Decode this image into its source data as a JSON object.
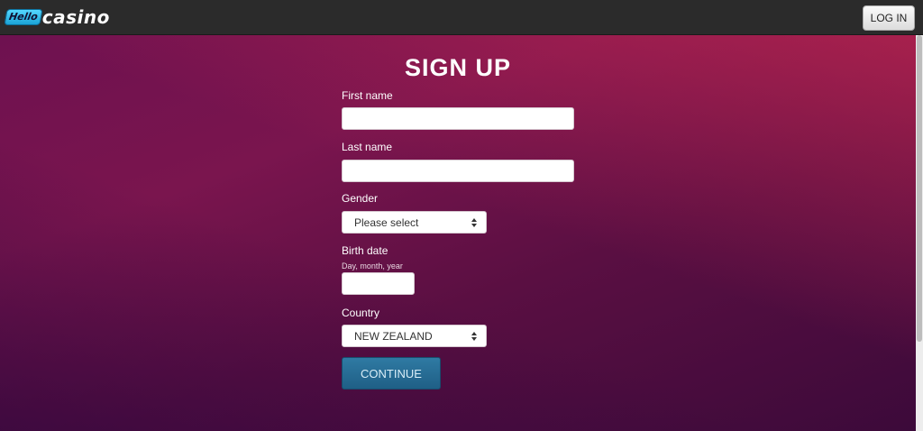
{
  "header": {
    "logo_badge": "Hello",
    "logo_text": "casino",
    "login_label": "LOG IN"
  },
  "form": {
    "title": "SIGN UP",
    "first_name": {
      "label": "First name",
      "value": ""
    },
    "last_name": {
      "label": "Last name",
      "value": ""
    },
    "gender": {
      "label": "Gender",
      "selected": "Please select"
    },
    "birth_date": {
      "label": "Birth date",
      "hint": "Day, month, year",
      "value": ""
    },
    "country": {
      "label": "Country",
      "selected": "NEW ZEALAND"
    },
    "continue_label": "CONTINUE"
  },
  "colors": {
    "header_bg": "#2b2b2b",
    "hero_primary": "#7a154e",
    "button_blue": "#2a6f98"
  }
}
